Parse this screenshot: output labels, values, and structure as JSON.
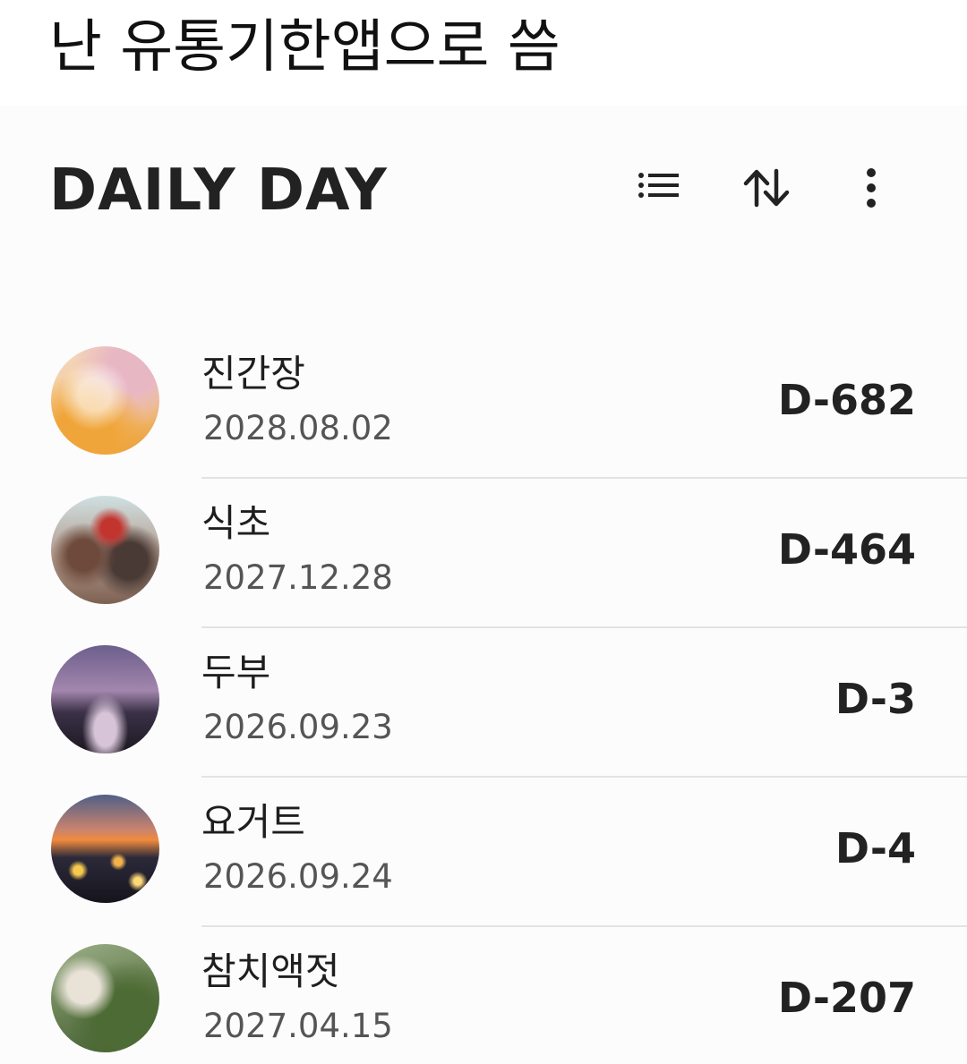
{
  "caption": "난 유통기한앱으로 씀",
  "app": {
    "title": "DAILY DAY",
    "toolbar": {
      "list_icon": "list-icon",
      "sort_icon": "sort-icon",
      "more_icon": "more-vertical-icon"
    }
  },
  "items": [
    {
      "name": "진간장",
      "date": "2028.08.02",
      "dday": "D-682"
    },
    {
      "name": "식초",
      "date": "2027.12.28",
      "dday": "D-464"
    },
    {
      "name": "두부",
      "date": "2026.09.23",
      "dday": "D-3"
    },
    {
      "name": "요거트",
      "date": "2026.09.24",
      "dday": "D-4"
    },
    {
      "name": "참치액젓",
      "date": "2027.04.15",
      "dday": "D-207"
    }
  ],
  "colors": {
    "text": "#222222",
    "date_text": "#555555",
    "divider": "#e3e3e6"
  }
}
